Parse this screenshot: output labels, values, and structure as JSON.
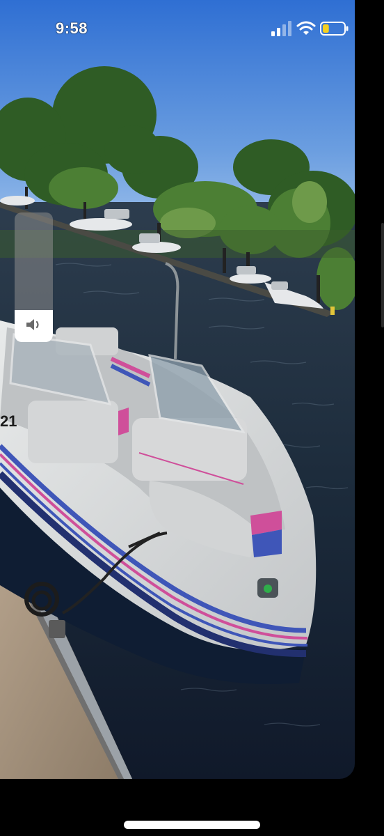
{
  "status_bar": {
    "time": "9:58",
    "signal_icon": "cellular-signal-icon",
    "wifi_icon": "wifi-icon",
    "battery_icon": "battery-low-icon",
    "battery_level": 0.3
  },
  "volume_hud": {
    "icon": "speaker-icon",
    "level": 0.25
  },
  "photo": {
    "hull_number_fragment": "21"
  },
  "colors": {
    "sky": "#4b83d8",
    "water": "#1b2c3f",
    "hull": "#d8dadb",
    "stripe_blue": "#3f56b8",
    "stripe_pink": "#cf4f9a",
    "foliage": "#3d6b2c"
  }
}
